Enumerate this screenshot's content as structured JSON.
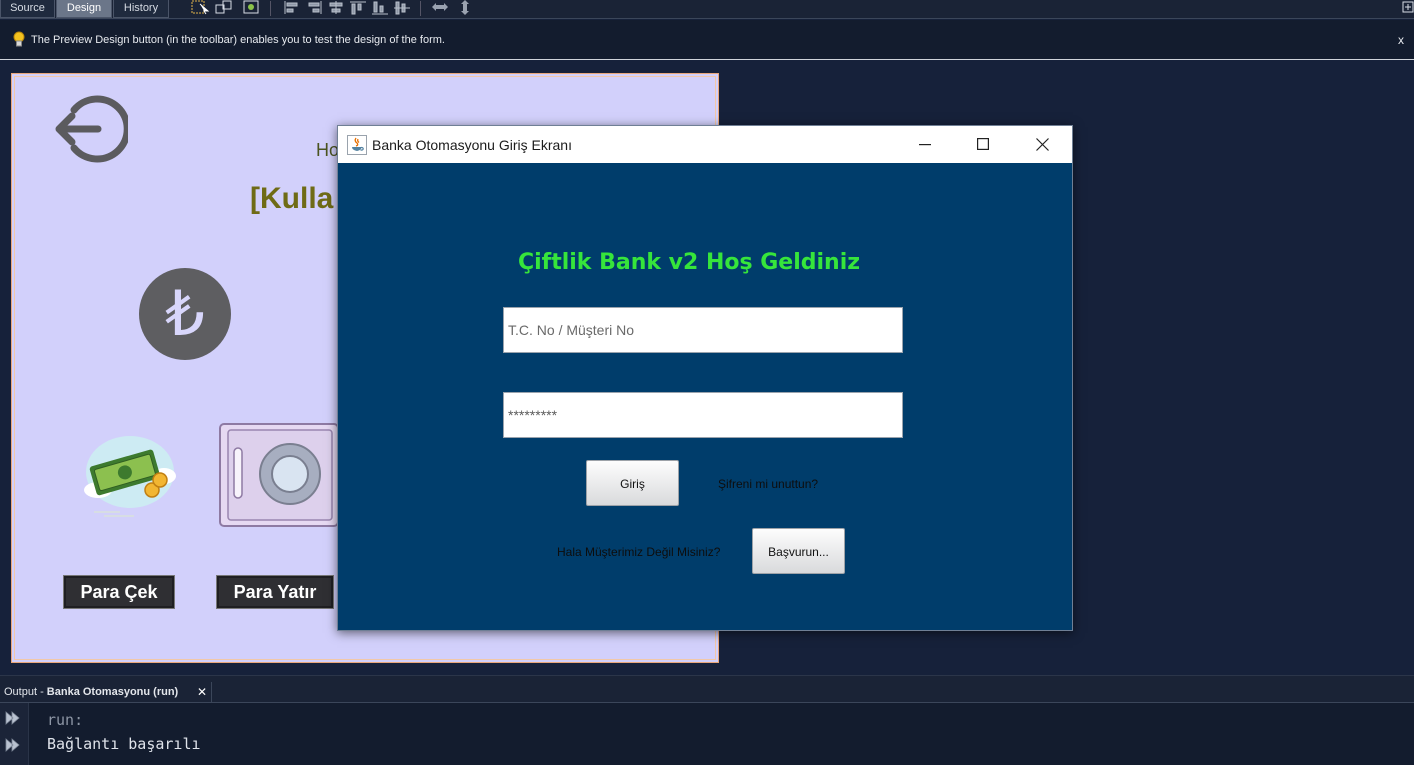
{
  "ide": {
    "tabs": [
      "Source",
      "Design",
      "History"
    ],
    "active_tab": "Design",
    "hint": "The Preview Design button (in the toolbar) enables you to test the design of the form.",
    "hint_close": "x"
  },
  "form_design": {
    "welcome_partial": "Ho",
    "user_partial": "[Kulla",
    "currency_symbol": "₺",
    "buttons": [
      "Para Çek",
      "Para Yatır"
    ]
  },
  "dialog": {
    "title": "Banka Otomasyonu Giriş Ekranı",
    "heading": "Çiftlik Bank v2 Hoş Geldiniz",
    "id_placeholder": "T.C. No / Müşteri No",
    "password_value": "*********",
    "login_button": "Giriş",
    "forgot_link": "Şifreni mi unuttun?",
    "not_customer_label": "Hala Müşterimiz Değil Misiniz?",
    "apply_button": "Başvurun..."
  },
  "output": {
    "tab_prefix": "Output - ",
    "tab_title": "Banka Otomasyonu (run)",
    "tab_close": "✕",
    "lines": [
      "run:",
      "Bağlantı başarılı"
    ]
  },
  "colors": {
    "ide_background": "#16213a",
    "canvas_background": "#d2d0fb",
    "dialog_background": "#003d6b",
    "heading_green": "#36e53b"
  }
}
